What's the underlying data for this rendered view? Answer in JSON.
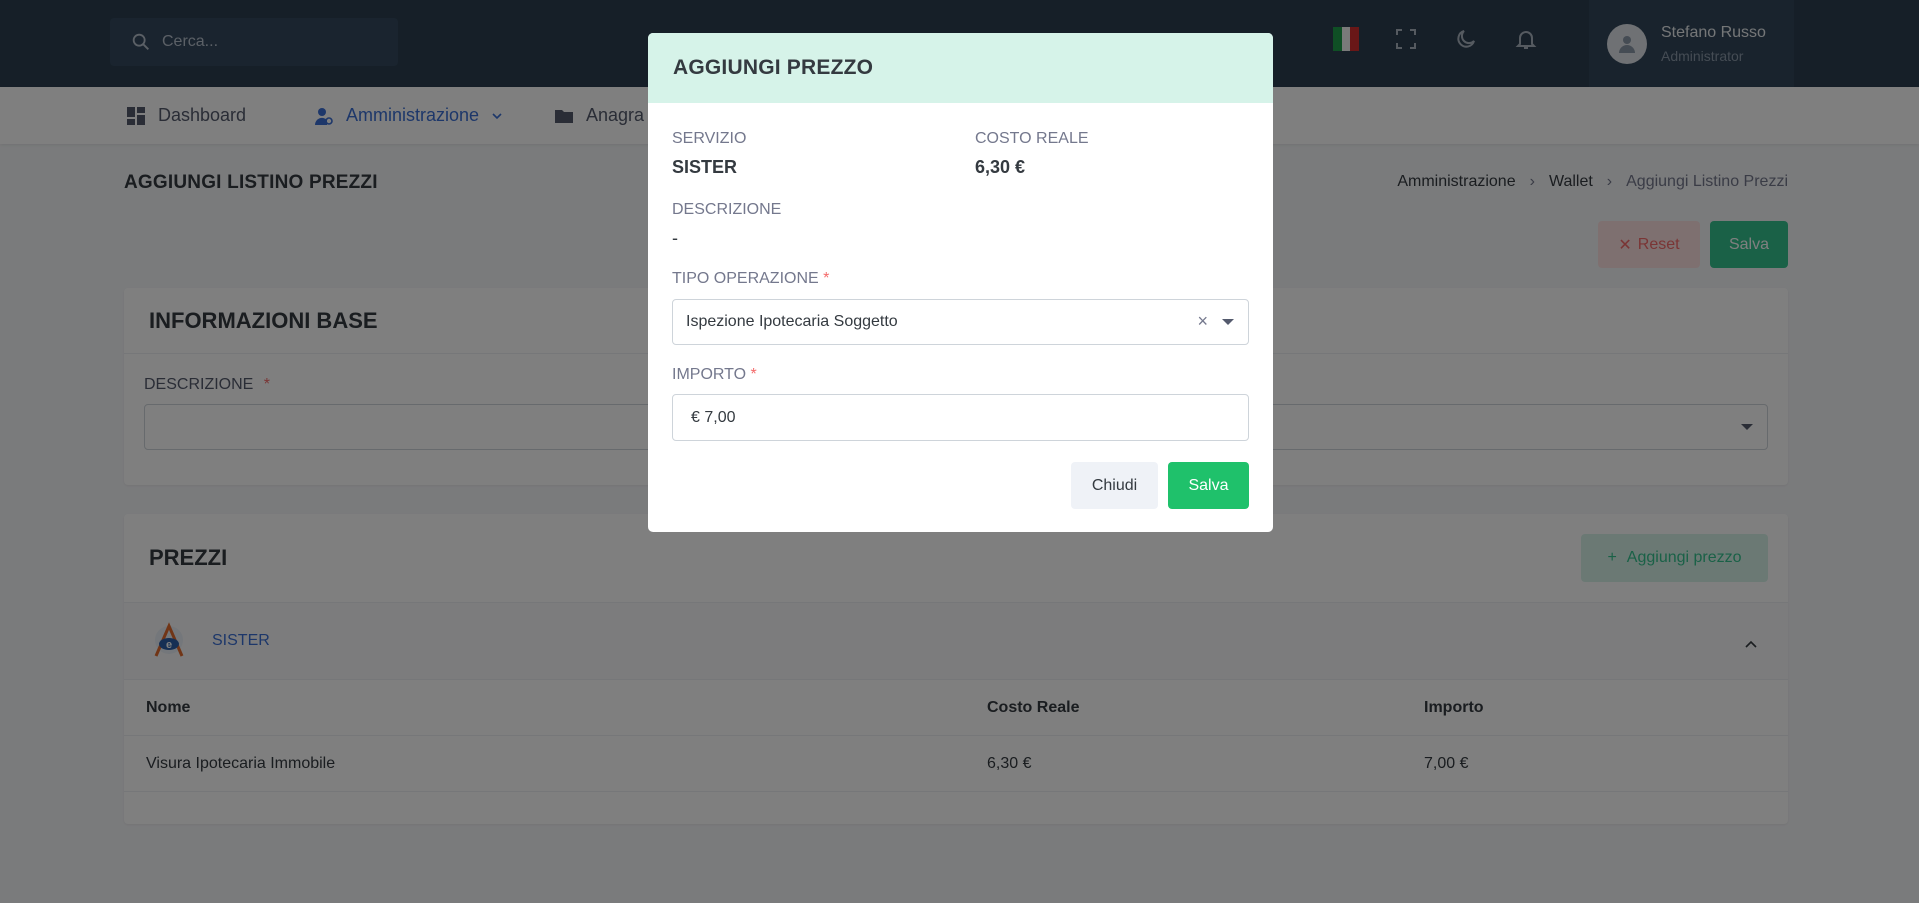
{
  "topbar": {
    "search_placeholder": "Cerca...",
    "user": {
      "name": "Stefano Russo",
      "role": "Administrator"
    },
    "icons": [
      "search-icon",
      "italy-flag-icon",
      "fullscreen-icon",
      "moon-icon",
      "bell-icon",
      "user-avatar-icon"
    ]
  },
  "nav": {
    "items": [
      {
        "label": "Dashboard",
        "icon": "dashboard-icon"
      },
      {
        "label": "Amministrazione",
        "icon": "admin-user-icon",
        "active": true
      },
      {
        "label": "Anagra",
        "icon": "folder-icon"
      }
    ]
  },
  "page": {
    "title": "AGGIUNGI LISTINO PREZZI",
    "breadcrumb": [
      "Amministrazione",
      "Wallet",
      "Aggiungi Listino Prezzi"
    ],
    "reset_label": "Reset",
    "save_label": "Salva"
  },
  "info_card": {
    "title": "INFORMAZIONI BASE",
    "description_label": "DESCRIZIONE",
    "required_mark": "*"
  },
  "prices_card": {
    "title": "PREZZI",
    "add_label": "Aggiungi prezzo",
    "service_name": "SISTER",
    "table": {
      "headers": [
        "Nome",
        "Costo Reale",
        "Importo"
      ],
      "rows": [
        [
          "Visura Ipotecaria Immobile",
          "6,30 €",
          "7,00 €"
        ]
      ]
    }
  },
  "modal": {
    "title": "AGGIUNGI PREZZO",
    "servizio_label": "SERVIZIO",
    "servizio_value": "SISTER",
    "costo_label": "COSTO REALE",
    "costo_value": "6,30 €",
    "descrizione_label": "DESCRIZIONE",
    "descrizione_value": "-",
    "tipo_label": "TIPO OPERAZIONE",
    "tipo_value": "Ispezione Ipotecaria Soggetto",
    "importo_label": "IMPORTO",
    "importo_value": "€ 7,00",
    "required_mark": "*",
    "close_label": "Chiudi",
    "save_label": "Salva"
  },
  "colors": {
    "topbar": "#2c3e50",
    "accent": "#3b6fd4",
    "success": "#1fc16b",
    "danger": "#f46a6a",
    "modal_header": "#d6f3e9"
  }
}
